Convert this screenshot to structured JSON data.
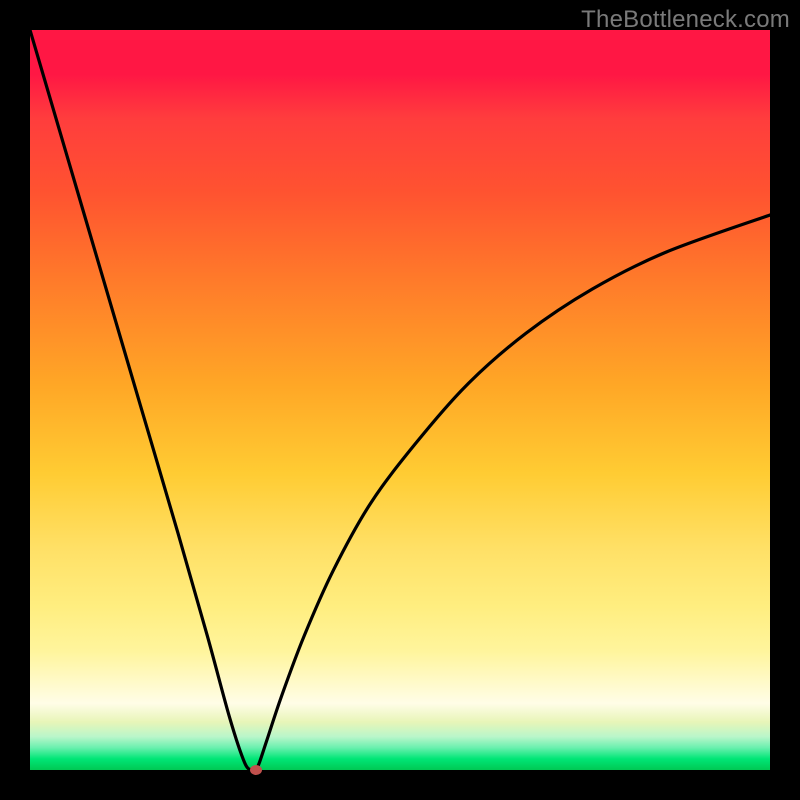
{
  "watermark": "TheBottleneck.com",
  "chart_data": {
    "type": "line",
    "title": "",
    "xlabel": "",
    "ylabel": "",
    "xlim": [
      0,
      100
    ],
    "ylim": [
      0,
      100
    ],
    "grid": false,
    "legend": false,
    "gradient_colors": {
      "high": "#ff1744",
      "mid": "#ffcc33",
      "low": "#00c853"
    },
    "series": [
      {
        "name": "bottleneck-curve",
        "x": [
          0,
          5,
          10,
          15,
          20,
          24,
          27,
          29,
          30,
          30.5,
          31,
          32,
          34,
          37,
          41,
          46,
          52,
          59,
          67,
          76,
          86,
          100
        ],
        "y": [
          100,
          83,
          66,
          49,
          32,
          18,
          7,
          1,
          0,
          0,
          1,
          4,
          10,
          18,
          27,
          36,
          44,
          52,
          59,
          65,
          70,
          75
        ]
      }
    ],
    "marker": {
      "name": "optimal-point",
      "x": 30.5,
      "y": 0,
      "color": "#c0504d"
    }
  }
}
